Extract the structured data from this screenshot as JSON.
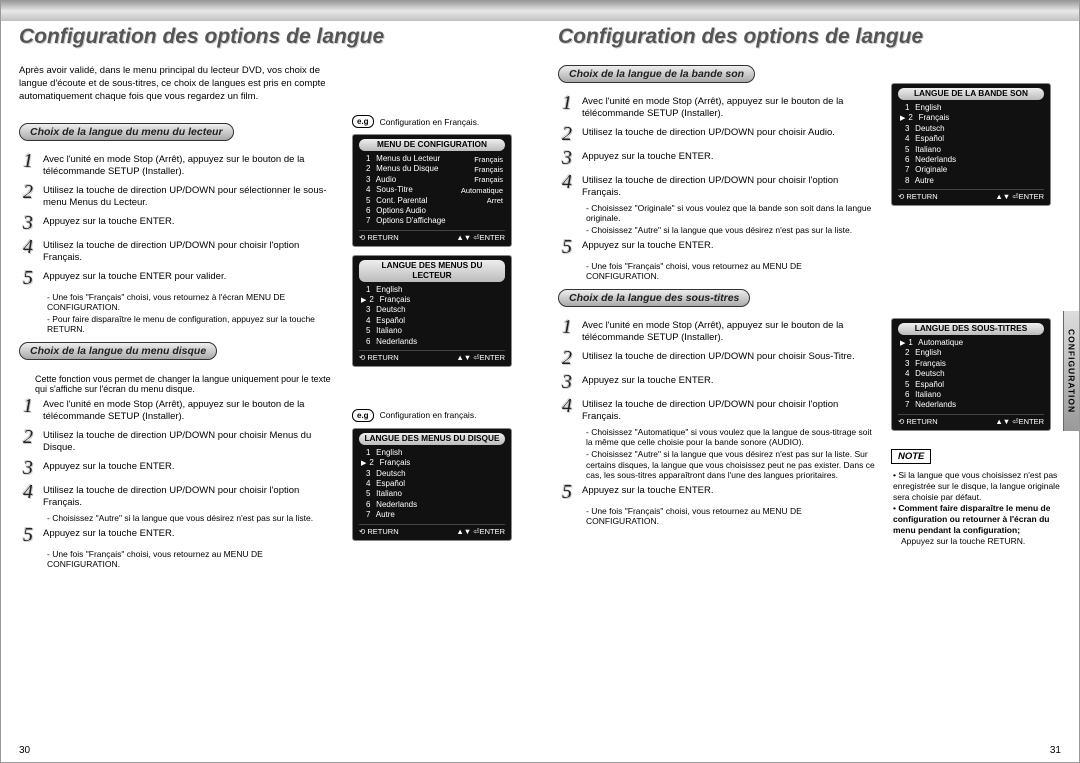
{
  "titles": {
    "left": "Configuration des options de langue",
    "right": "Configuration des options de langue"
  },
  "intro": "Après avoir validé, dans le menu principal du lecteur DVD, vos choix de langue d'écoute et de sous-titres, ce choix de langues est pris en compte automatiquement chaque fois que vous regardez un film.",
  "pills": {
    "playerMenu": "Choix de la langue du menu du lecteur",
    "discMenu": "Choix de la langue du menu disque",
    "audio": "Choix de la langue de la bande son",
    "subtitles": "Choix de la langue des sous-titres"
  },
  "playerMenuSteps": [
    "Avec l'unité en mode Stop (Arrêt), appuyez sur le bouton de la télécommande SETUP (Installer).",
    "Utilisez la touche de direction UP/DOWN pour sélectionner le sous-menu Menus du Lecteur.",
    "Appuyez sur la touche ENTER.",
    "Utilisez la touche de direction UP/DOWN pour choisir l'option Français.",
    "Appuyez sur la touche ENTER pour valider."
  ],
  "playerMenuSubs": [
    "- Une fois \"Français\" choisi, vous retournez à l'écran MENU DE CONFIGURATION.",
    "- Pour faire disparaître le menu de configuration, appuyez sur la touche RETURN."
  ],
  "discMenuIntro": "Cette fonction vous permet de changer la langue uniquement pour le texte qui s'affiche sur l'écran du menu disque.",
  "discMenuSteps": [
    "Avec l'unité en mode Stop (Arrêt), appuyez sur le bouton de la télécommande SETUP (Installer).",
    "Utilisez la touche de direction UP/DOWN pour choisir Menus du Disque.",
    "Appuyez sur la touche ENTER.",
    "Utilisez la touche de direction UP/DOWN pour choisir l'option Français."
  ],
  "discMenuSub4": "- Choisissez \"Autre\" si la langue que vous désirez n'est pas sur la liste.",
  "discMenuStep5": "Appuyez sur la touche ENTER.",
  "discMenuSub5": "- Une fois \"Français\" choisi, vous retournez au MENU DE CONFIGURATION.",
  "eg1": "Configuration en Français.",
  "eg2": "Configuration en français.",
  "eg_label": "e.g",
  "osd_labels": {
    "return": "RETURN",
    "enter": "ENTER"
  },
  "osd1": {
    "title": "MENU DE CONFIGURATION",
    "rows": [
      [
        "1",
        "Menus du Lecteur",
        "Français"
      ],
      [
        "2",
        "Menus du Disque",
        "Français"
      ],
      [
        "3",
        "Audio",
        "Français"
      ],
      [
        "4",
        "Sous-Titre",
        "Automatique"
      ],
      [
        "5",
        "Cont. Parental",
        "Arret"
      ],
      [
        "6",
        "Options Audio",
        ""
      ],
      [
        "7",
        "Options D'affichage",
        ""
      ]
    ]
  },
  "osd2": {
    "title": "LANGUE DES MENUS DU LECTEUR",
    "rows": [
      [
        "1",
        "English"
      ],
      [
        "2",
        "Français"
      ],
      [
        "3",
        "Deutsch"
      ],
      [
        "4",
        "Español"
      ],
      [
        "5",
        "Italiano"
      ],
      [
        "6",
        "Nederlands"
      ]
    ],
    "selected": 1
  },
  "osd3": {
    "title": "LANGUE DES MENUS DU DISQUE",
    "rows": [
      [
        "1",
        "English"
      ],
      [
        "2",
        "Français"
      ],
      [
        "3",
        "Deutsch"
      ],
      [
        "4",
        "Español"
      ],
      [
        "5",
        "Italiano"
      ],
      [
        "6",
        "Nederlands"
      ],
      [
        "7",
        "Autre"
      ]
    ],
    "selected": 1
  },
  "audioSteps": [
    "Avec l'unité en mode Stop (Arrêt), appuyez sur le bouton de la télécommande SETUP (Installer).",
    "Utilisez la touche de direction UP/DOWN pour choisir Audio.",
    "Appuyez sur la touche ENTER.",
    "Utilisez la touche de direction UP/DOWN pour choisir l'option Français."
  ],
  "audioSub4a": "- Choisissez \"Originale\" si vous voulez que la bande son soit dans la langue originale.",
  "audioSub4b": "- Choisissez \"Autre\" si la langue que vous désirez n'est pas sur la liste.",
  "audioStep5": "Appuyez sur la touche ENTER.",
  "audioSub5": "- Une fois \"Français\" choisi, vous retournez au MENU DE CONFIGURATION.",
  "subSteps": [
    "Avec l'unité en mode Stop (Arrêt), appuyez sur le bouton de la télécommande SETUP (Installer).",
    "Utilisez la touche de direction UP/DOWN pour choisir Sous-Titre.",
    "Appuyez sur la touche ENTER.",
    "Utilisez la touche de direction UP/DOWN pour choisir l'option Français."
  ],
  "subSub4a": "- Choisissez \"Automatique\" si vous voulez que la langue de sous-titrage soit la même que celle choisie pour la bande sonore (AUDIO).",
  "subSub4b": "- Choisissez \"Autre\" si la langue que vous désirez n'est pas sur la liste. Sur certains disques, la langue que vous choisissez peut ne pas exister. Dans ce cas, les sous-titres apparaîtront dans l'une des langues prioritaires.",
  "subStep5": "Appuyez sur la touche ENTER.",
  "subSub5": "- Une fois \"Français\" choisi, vous retournez au MENU DE CONFIGURATION.",
  "osd4": {
    "title": "LANGUE DE LA BANDE SON",
    "rows": [
      [
        "1",
        "English"
      ],
      [
        "2",
        "Français"
      ],
      [
        "3",
        "Deutsch"
      ],
      [
        "4",
        "Español"
      ],
      [
        "5",
        "Italiano"
      ],
      [
        "6",
        "Nederlands"
      ],
      [
        "7",
        "Originale"
      ],
      [
        "8",
        "Autre"
      ]
    ],
    "selected": 1
  },
  "osd5": {
    "title": "LANGUE DES SOUS-TITRES",
    "rows": [
      [
        "1",
        "Automatique"
      ],
      [
        "2",
        "English"
      ],
      [
        "3",
        "Français"
      ],
      [
        "4",
        "Deutsch"
      ],
      [
        "5",
        "Español"
      ],
      [
        "6",
        "Italiano"
      ],
      [
        "7",
        "Nederlands"
      ]
    ],
    "selected": 0
  },
  "noteLabel": "NOTE",
  "note1": "Si la langue que vous choisissez n'est pas enregistrée sur le disque, la langue originale sera choisie par défaut.",
  "note2": "Comment faire disparaître le menu de configuration ou retourner à l'écran du menu pendant la configuration;",
  "note3": "Appuyez sur la touche RETURN.",
  "pageNumbers": {
    "left": "30",
    "right": "31"
  },
  "sideTab": "CONFIGURATION"
}
